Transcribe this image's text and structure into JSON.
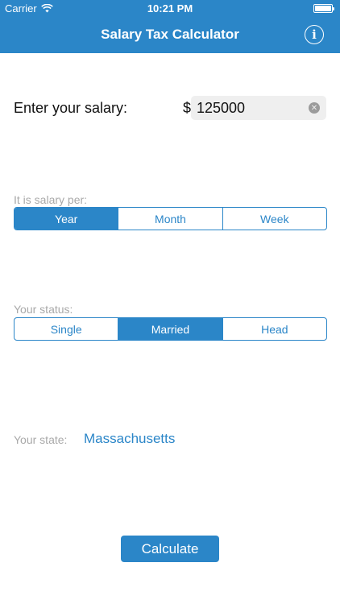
{
  "status_bar": {
    "carrier": "Carrier",
    "time": "10:21 PM"
  },
  "nav": {
    "title": "Salary Tax Calculator",
    "info_icon": "i"
  },
  "salary": {
    "label": "Enter your salary:",
    "currency": "$",
    "value": "125000"
  },
  "period": {
    "label": "It is salary per:",
    "options": [
      "Year",
      "Month",
      "Week"
    ],
    "selected": "Year"
  },
  "status": {
    "label": "Your status:",
    "options": [
      "Single",
      "Married",
      "Head"
    ],
    "selected": "Married"
  },
  "state": {
    "label": "Your state:",
    "value": "Massachusetts"
  },
  "actions": {
    "calculate_label": "Calculate"
  },
  "colors": {
    "accent": "#2b86c8",
    "muted_label": "#a9a9a9",
    "input_bg": "#efefef"
  }
}
